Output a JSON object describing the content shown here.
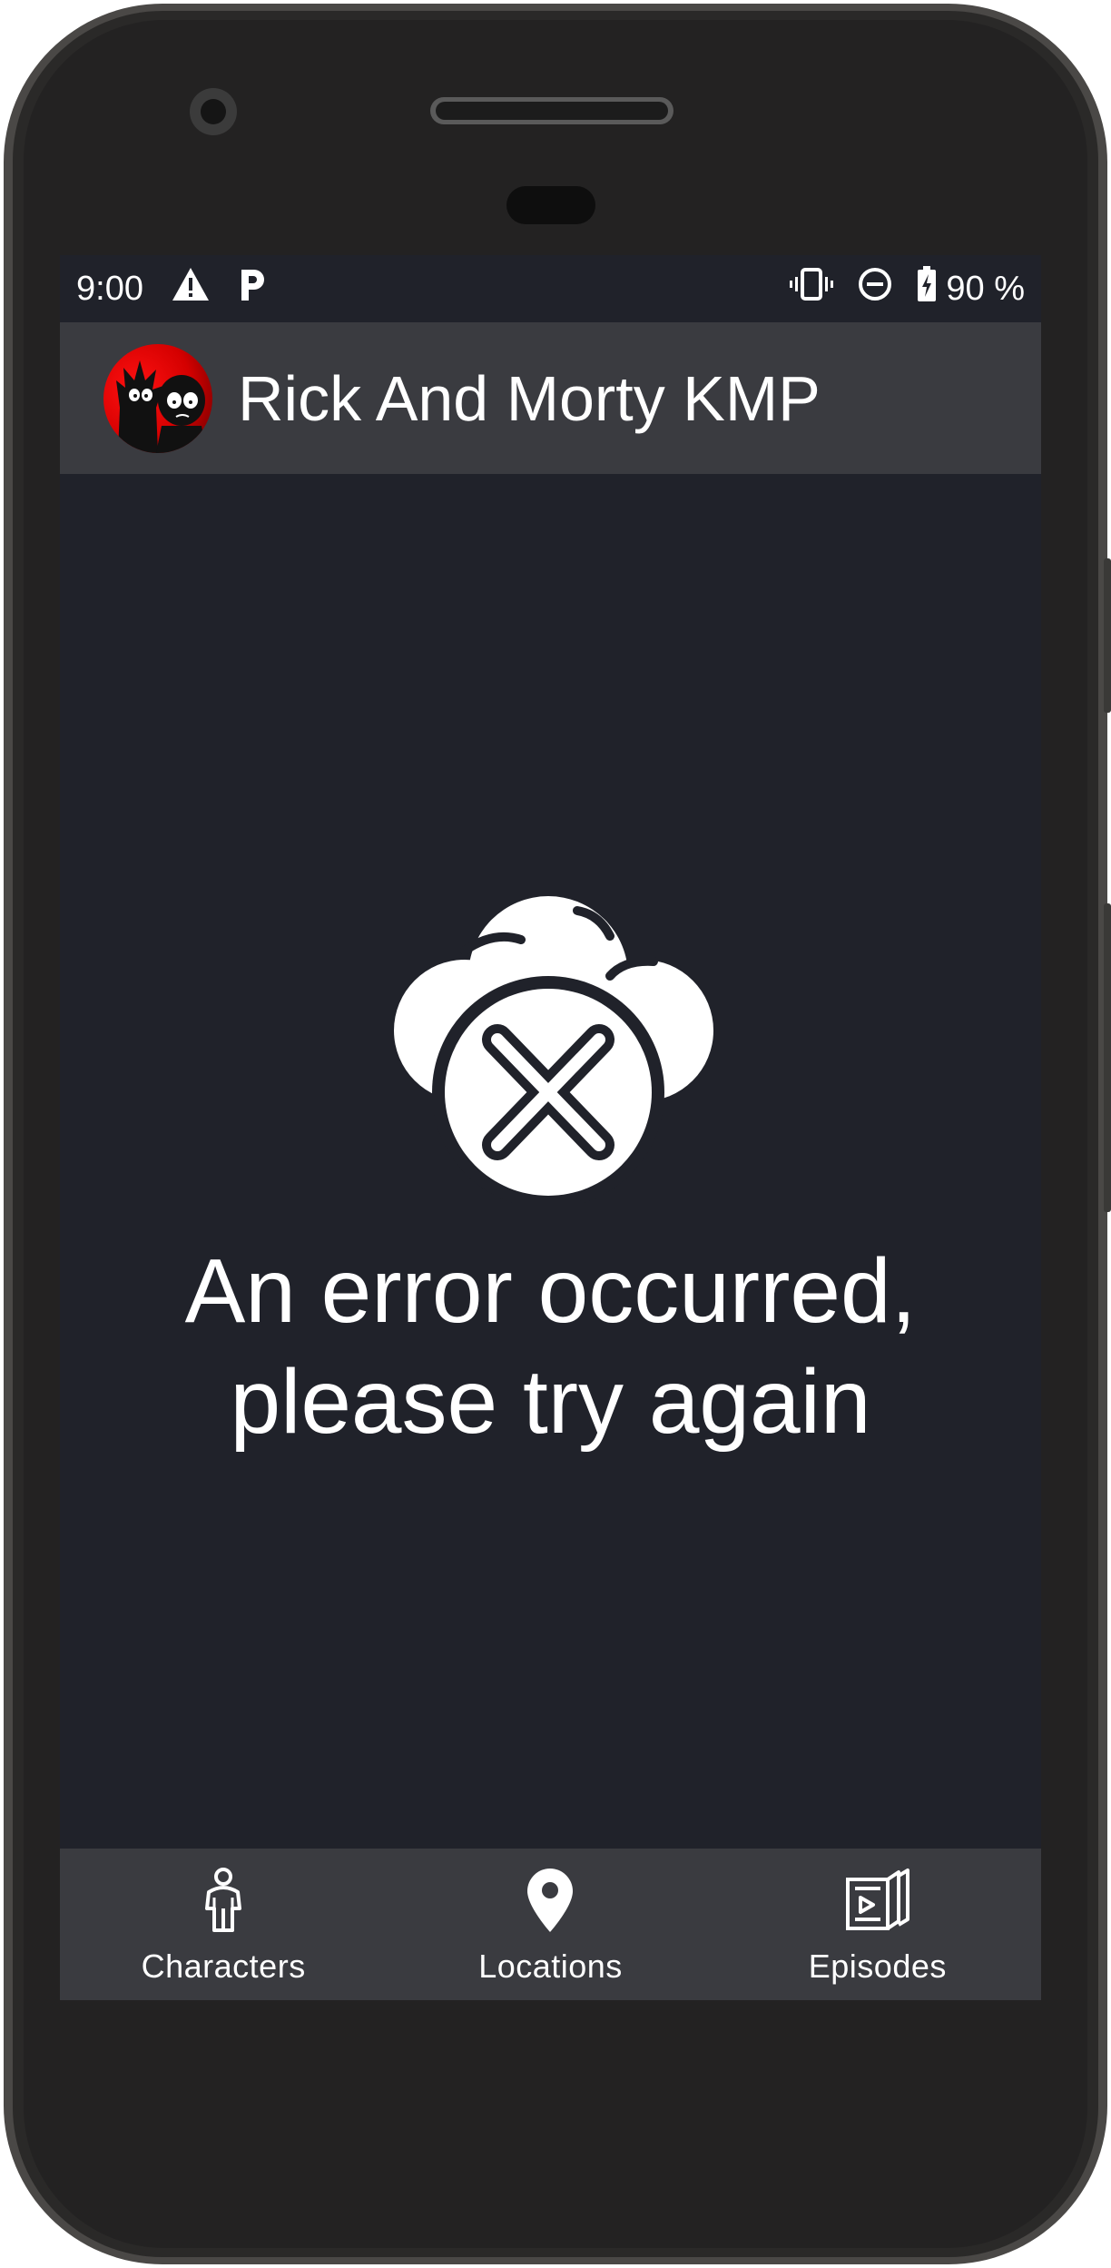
{
  "status_bar": {
    "time": "9:00",
    "left_icons": [
      "warning-icon",
      "parking-icon"
    ],
    "right_icons": [
      "vibrate-icon",
      "do-not-disturb-icon",
      "battery-charging-icon"
    ],
    "battery": "90 %"
  },
  "top_bar": {
    "title": "Rick And Morty KMP",
    "avatar_icon": "rick-and-morty-avatar"
  },
  "error": {
    "icon": "cloud-error-icon",
    "line1": "An error occurred,",
    "line2": "please try again"
  },
  "bottom_nav": {
    "items": [
      {
        "label": "Characters",
        "icon": "person-icon"
      },
      {
        "label": "Locations",
        "icon": "location-pin-icon"
      },
      {
        "label": "Episodes",
        "icon": "book-play-icon"
      }
    ]
  },
  "colors": {
    "background": "#20222a",
    "bar": "#3a3b40",
    "frame": "#1e1e1e",
    "text": "#ffffff",
    "avatar": "#e00000"
  }
}
